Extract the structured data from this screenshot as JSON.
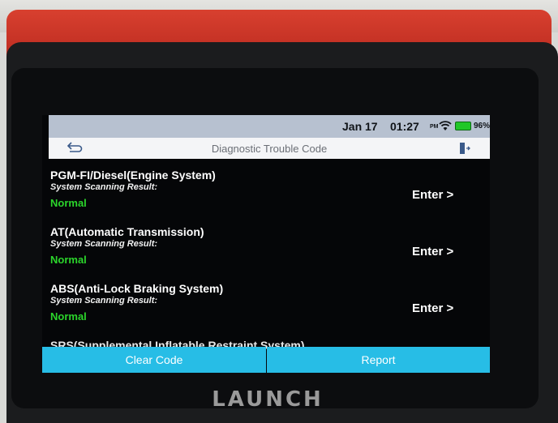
{
  "status": {
    "date": "Jan 17",
    "time": "01:27",
    "ampm": "PM",
    "battery": "96%",
    "battery_color": "#21c728"
  },
  "header": {
    "title": "Diagnostic Trouble Code",
    "back_icon": "back-arrow-icon",
    "exit_icon": "exit-icon"
  },
  "systems": [
    {
      "name": "PGM-FI/Diesel(Engine System)",
      "label": "System Scanning Result:",
      "result": "Normal",
      "enter": "Enter >"
    },
    {
      "name": "AT(Automatic Transmission)",
      "label": "System Scanning Result:",
      "result": "Normal",
      "enter": "Enter >"
    },
    {
      "name": "ABS(Anti-Lock Braking System)",
      "label": "System Scanning Result:",
      "result": "Normal",
      "enter": "Enter >"
    },
    {
      "name": "SRS(Supplemental Inflatable Restraint System)"
    }
  ],
  "buttons": {
    "clear": "Clear Code",
    "report": "Report"
  },
  "colors": {
    "accent": "#27bde6",
    "normal": "#2bd52b",
    "device_red": "#c8301f"
  },
  "device": {
    "brand": "LAUNCH"
  }
}
